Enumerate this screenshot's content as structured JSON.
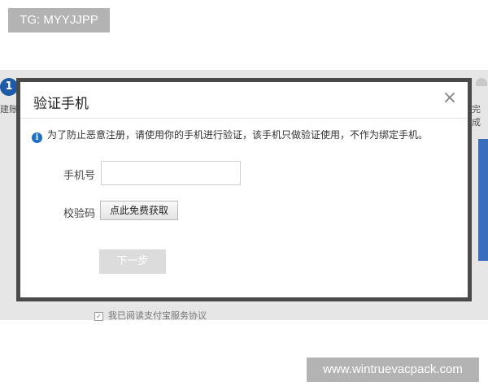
{
  "watermarks": {
    "top_left": "TG: MYYJJPP",
    "bottom_right": "www.wintruevacpack.com"
  },
  "background_page": {
    "step_number": "1",
    "left_step_fragment": "建账",
    "right_step_fragment": "完成",
    "agreement_fragment": "我已阅读支付宝服务协议"
  },
  "dialog": {
    "title": "验证手机",
    "close_symbol": "×",
    "info_text": "为了防止恶意注册，请使用你的手机进行验证，该手机只做验证使用，不作为绑定手机。",
    "phone_label": "手机号",
    "phone_value": "",
    "phone_placeholder": "",
    "code_label": "校验码",
    "get_code_button": "点此免费获取",
    "next_button": "下一步"
  },
  "colors": {
    "accent_blue": "#1e5aa8",
    "info_icon": "#1f6fc5",
    "dialog_border": "#4a4a4a",
    "disabled_button": "#dcdcdc"
  }
}
